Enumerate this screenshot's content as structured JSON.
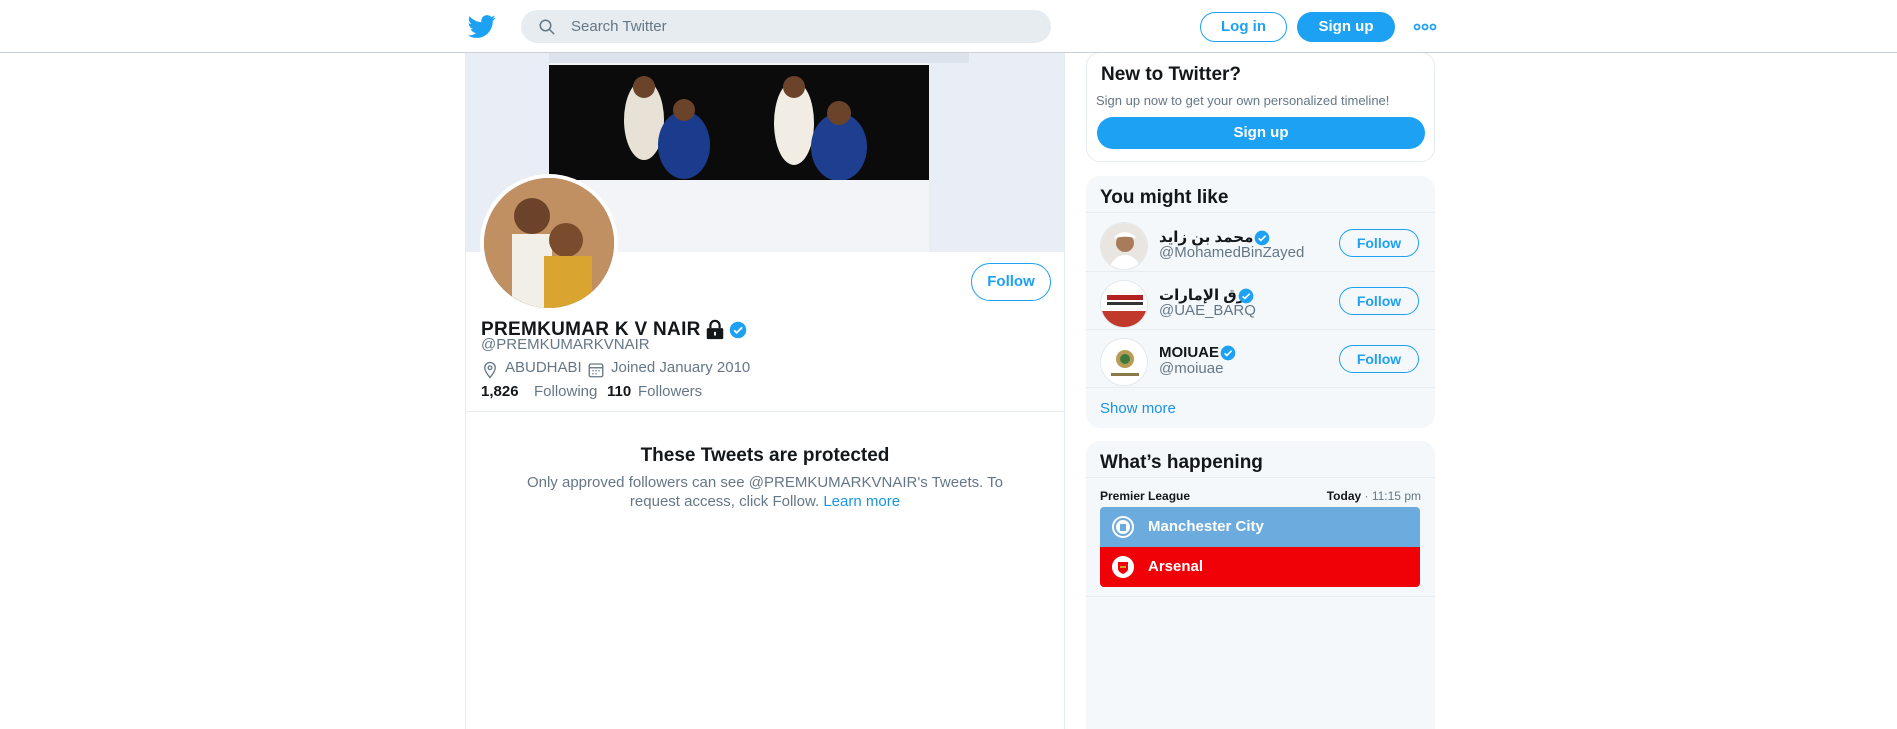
{
  "header": {
    "search_placeholder": "Search Twitter",
    "login_label": "Log in",
    "signup_label": "Sign up",
    "brand_color": "#1da1f2"
  },
  "profile": {
    "name": "PREMKUMAR K V NAIR",
    "handle": "@PREMKUMARKVNAIR",
    "location": "ABUDHABI",
    "joined": "Joined January 2010",
    "following_count": "1,826",
    "following_label": "Following",
    "followers_count": "110",
    "followers_label": "Followers",
    "follow_label": "Follow",
    "verified": true,
    "protected": true
  },
  "protected_notice": {
    "title": "These Tweets are protected",
    "text": "Only approved followers can see @PREMKUMARKVNAIR's Tweets. To request access, click Follow.",
    "link": "Learn more"
  },
  "new_to_twitter": {
    "title": "New to Twitter?",
    "subtitle": "Sign up now to get your own personalized timeline!",
    "button": "Sign up"
  },
  "you_might_like": {
    "title": "You might like",
    "users": [
      {
        "name": "محمد بن زايد",
        "handle": "@MohamedBinZayed",
        "follow": "Follow"
      },
      {
        "name": "برق الإمارات",
        "handle": "@UAE_BARQ",
        "follow": "Follow"
      },
      {
        "name": "MOIUAE",
        "handle": "@moiuae",
        "follow": "Follow"
      }
    ],
    "show_more": "Show more"
  },
  "whats_happening": {
    "title": "What’s happening",
    "league": "Premier League",
    "day": "Today",
    "time": "11:15 pm",
    "teams": [
      {
        "name": "Manchester City",
        "color": "#6cabdd"
      },
      {
        "name": "Arsenal",
        "color": "#ef0107"
      }
    ]
  }
}
